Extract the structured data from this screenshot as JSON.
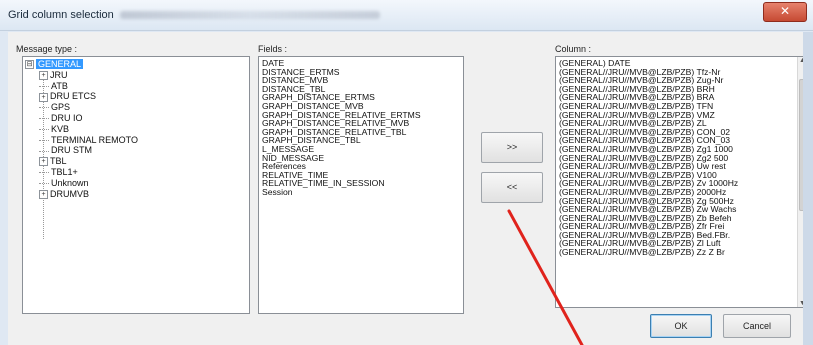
{
  "window": {
    "title": "Grid column selection",
    "close_glyph": "✕"
  },
  "labels": {
    "message_type": "Message type :",
    "fields": "Fields :",
    "column": "Column :"
  },
  "tree": {
    "root": {
      "label": "GENERAL",
      "expander": "⊟"
    },
    "items": [
      {
        "label": "JRU",
        "expander": "+"
      },
      {
        "label": "ATB",
        "expander": ""
      },
      {
        "label": "DRU ETCS",
        "expander": "+"
      },
      {
        "label": "GPS",
        "expander": ""
      },
      {
        "label": "DRU IO",
        "expander": ""
      },
      {
        "label": "KVB",
        "expander": ""
      },
      {
        "label": "TERMINAL REMOTO",
        "expander": ""
      },
      {
        "label": "DRU STM",
        "expander": ""
      },
      {
        "label": "TBL",
        "expander": "+"
      },
      {
        "label": "TBL1+",
        "expander": ""
      },
      {
        "label": "Unknown",
        "expander": ""
      },
      {
        "label": "DRUMVB",
        "expander": "+"
      }
    ]
  },
  "fields": [
    "DATE",
    "DISTANCE_ERTMS",
    "DISTANCE_MVB",
    "DISTANCE_TBL",
    "GRAPH_DISTANCE_ERTMS",
    "GRAPH_DISTANCE_MVB",
    "GRAPH_DISTANCE_RELATIVE_ERTMS",
    "GRAPH_DISTANCE_RELATIVE_MVB",
    "GRAPH_DISTANCE_RELATIVE_TBL",
    "GRAPH_DISTANCE_TBL",
    "L_MESSAGE",
    "NID_MESSAGE",
    "References",
    "RELATIVE_TIME",
    "RELATIVE_TIME_IN_SESSION",
    "Session"
  ],
  "buttons": {
    "add": ">>",
    "remove": "<<",
    "ok": "OK",
    "cancel": "Cancel"
  },
  "columns": [
    "(GENERAL) DATE",
    "(GENERAL//JRU//MVB@LZB/PZB) Tfz-Nr",
    "(GENERAL//JRU//MVB@LZB/PZB) Zug-Nr",
    "(GENERAL//JRU//MVB@LZB/PZB) BRH",
    "(GENERAL//JRU//MVB@LZB/PZB) BRA",
    "(GENERAL//JRU//MVB@LZB/PZB) TFN",
    "(GENERAL//JRU//MVB@LZB/PZB) VMZ",
    "(GENERAL//JRU//MVB@LZB/PZB) ZL",
    "(GENERAL//JRU//MVB@LZB/PZB) CON_02",
    "(GENERAL//JRU//MVB@LZB/PZB) CON_03",
    "(GENERAL//JRU//MVB@LZB/PZB) Zg1 1000",
    "(GENERAL//JRU//MVB@LZB/PZB) Zg2 500",
    "(GENERAL//JRU//MVB@LZB/PZB) Uw rest",
    "(GENERAL//JRU//MVB@LZB/PZB) V100",
    "(GENERAL//JRU//MVB@LZB/PZB) Zv 1000Hz",
    "(GENERAL//JRU//MVB@LZB/PZB) 2000Hz",
    "(GENERAL//JRU//MVB@LZB/PZB) Zg 500Hz",
    "(GENERAL//JRU//MVB@LZB/PZB) Zw Wachs",
    "(GENERAL//JRU//MVB@LZB/PZB) Zb Befeh",
    "(GENERAL//JRU//MVB@LZB/PZB) Zfr Frei",
    "(GENERAL//JRU//MVB@LZB/PZB) Bed.FBr.",
    "(GENERAL//JRU//MVB@LZB/PZB) Zl Luft",
    "(GENERAL//JRU//MVB@LZB/PZB) Zz Z Br"
  ],
  "scrollbar": {
    "up_glyph": "▲",
    "down_glyph": "▼"
  },
  "colors": {
    "selection": "#3399ff",
    "annotation_arrow": "#e0231c",
    "close_button": "#c64a33"
  }
}
